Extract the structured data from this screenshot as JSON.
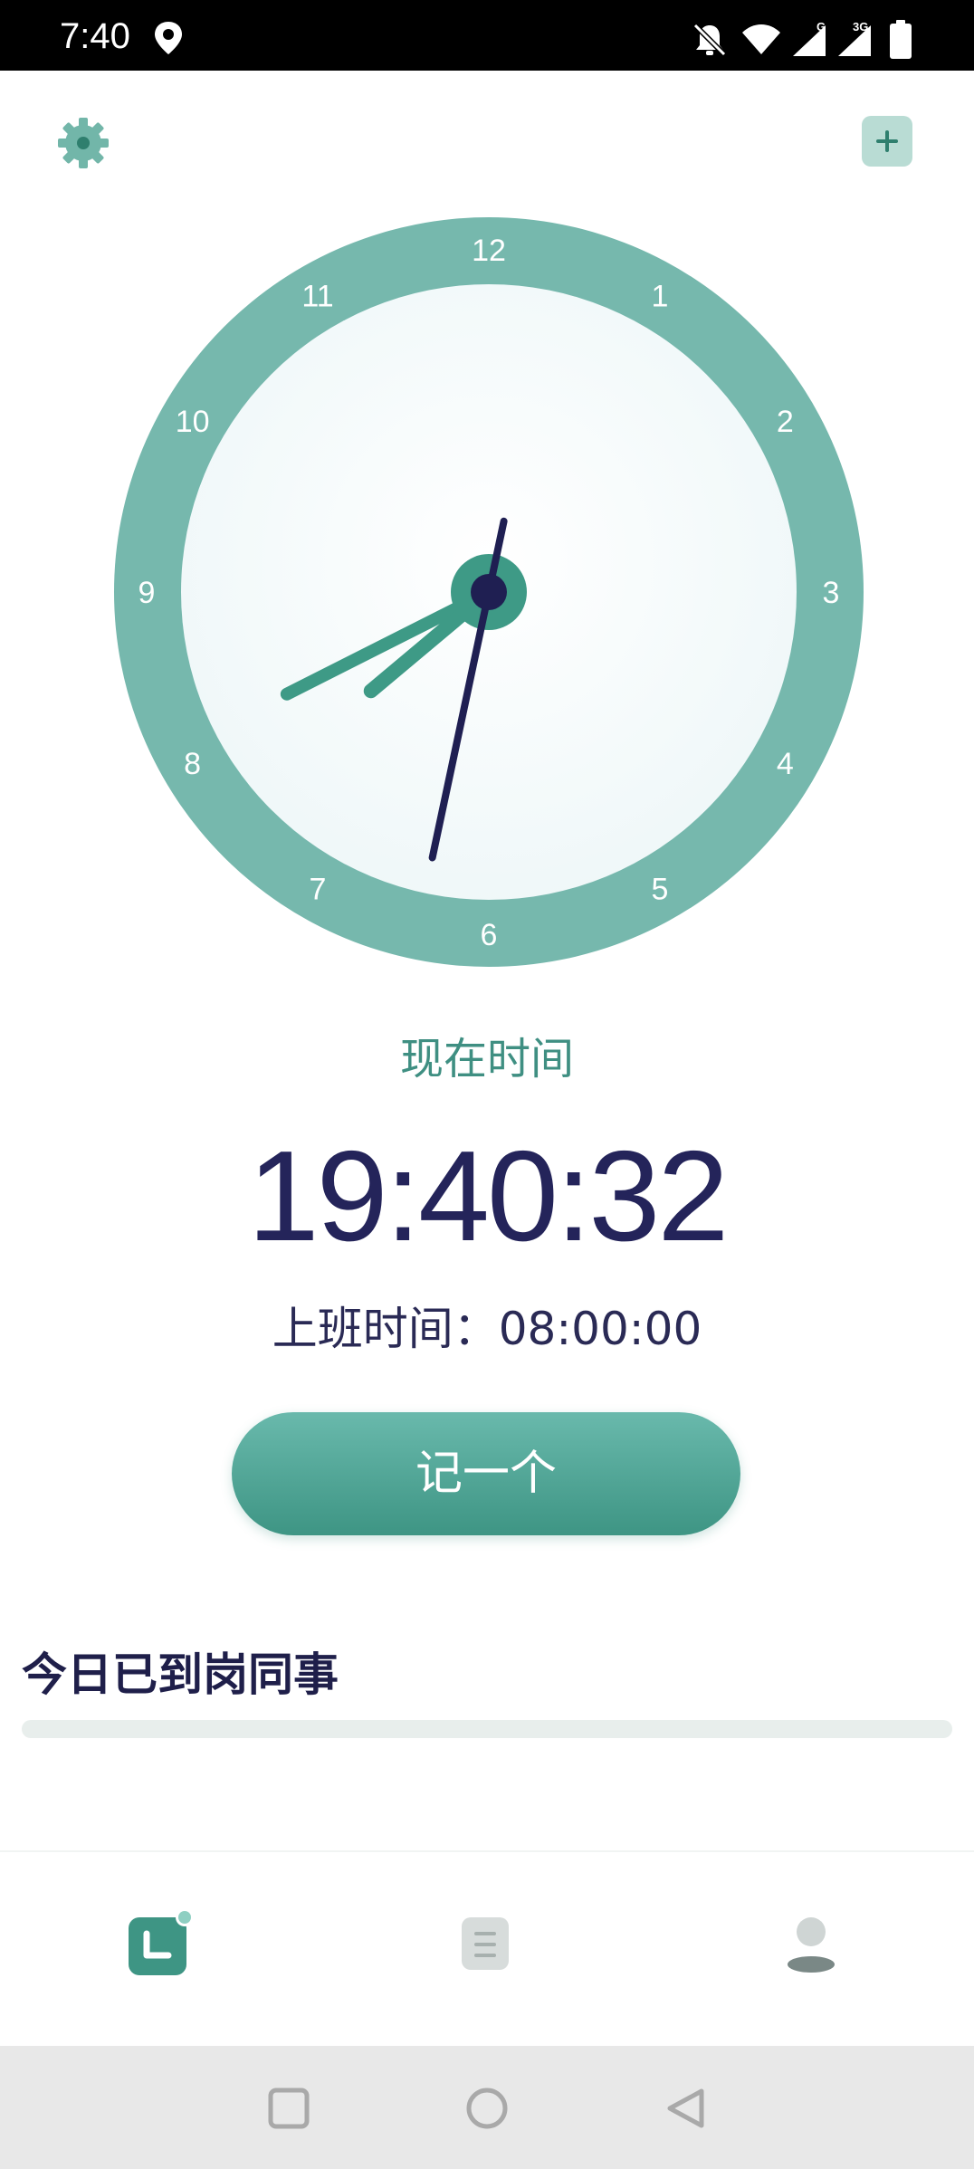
{
  "status_bar": {
    "time": "7:40",
    "icons": [
      "location-icon",
      "bell-off-icon",
      "wifi-icon",
      "signal-g-icon",
      "signal-3g-icon",
      "battery-icon"
    ],
    "network_label_1": "G",
    "network_label_2": "3G"
  },
  "header": {
    "settings_icon": "gear-icon",
    "add_icon": "plus-icon"
  },
  "clock": {
    "numbers": [
      "12",
      "1",
      "2",
      "3",
      "4",
      "5",
      "6",
      "7",
      "8",
      "9",
      "10",
      "11"
    ],
    "time_shown": "19:40:32",
    "colors": {
      "ring": "#76b8ad",
      "face": "#f6fbfc",
      "hands": "#3e9a86",
      "second_hand": "#1f1f52"
    }
  },
  "main": {
    "now_label": "现在时间",
    "current_time": "19:40:32",
    "work_time_text": "上班时间：08:00:00",
    "record_button_label": "记一个"
  },
  "colleagues": {
    "title": "今日已到岗同事"
  },
  "bottom_nav": {
    "items": [
      {
        "icon": "clock-home-icon",
        "active": true
      },
      {
        "icon": "document-list-icon",
        "active": false
      },
      {
        "icon": "user-icon",
        "active": false
      }
    ]
  },
  "system_nav": {
    "buttons": [
      "recent-apps-icon",
      "home-icon",
      "back-icon"
    ]
  },
  "colors": {
    "accent": "#3e9584",
    "accent_light": "#b9dcd4",
    "text_dark": "#24245a"
  }
}
